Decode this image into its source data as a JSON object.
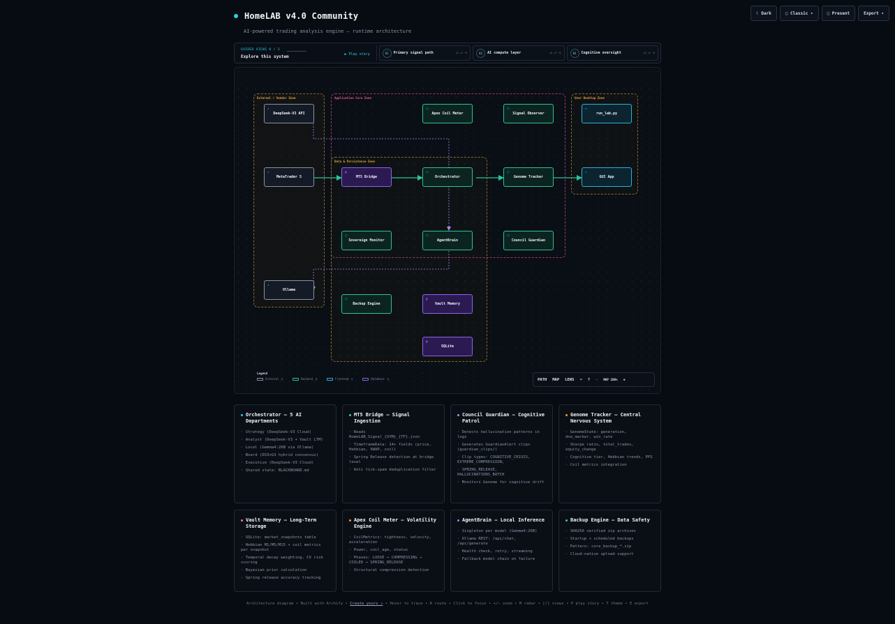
{
  "header": {
    "title": "HomeLAB v4.0 Community",
    "subtitle": "AI-powered trading analysis engine — runtime architecture"
  },
  "controls": {
    "dark": "☾ Dark",
    "classic": "▢ Classic ▾",
    "present": "▢ Present",
    "export": "Export ▾"
  },
  "guided": {
    "kicker": "GUIDED VIEWS 0 / 3",
    "heading": "Explore this system",
    "play": "▶ Play story",
    "views": [
      {
        "num": "01",
        "label": "Primary signal path",
        "stats": "+8 +5 −8"
      },
      {
        "num": "02",
        "label": "AI compute layer",
        "stats": "+8 +5 −8"
      },
      {
        "num": "03",
        "label": "Cognitive oversight",
        "stats": "+8 +5 −8"
      }
    ]
  },
  "zones": {
    "external": "External / Vendor Zone",
    "appcore": "Application Core Zone",
    "data": "Data & Persistence Zone",
    "desktop": "User Desktop Zone"
  },
  "nodes": {
    "deepseek": "DeepSeek-V3 API",
    "metatrader": "MetaTrader 5",
    "ollama": "Ollama",
    "apex": "Apex Coil Meter",
    "signal_observer": "Signal Observer",
    "run_lab": "run_lab.py",
    "mt5_bridge": "MT5 Bridge",
    "orchestrator": "Orchestrator",
    "genome_tracker": "Genome Tracker",
    "gui_app": "GUI App",
    "sovereign": "Sovereign Monitor",
    "agentbrain": "AgentBrain",
    "council": "Council Guardian",
    "backup": "Backup Engine",
    "vault": "Vault Memory",
    "sqlite": "SQLite"
  },
  "legend": {
    "title": "Legend",
    "items": [
      {
        "label": "External",
        "count": "3",
        "color": "#8793a6"
      },
      {
        "label": "Backend",
        "count": "8",
        "color": "#2cc29a"
      },
      {
        "label": "Frontend",
        "count": "2",
        "color": "#2bb3d6"
      },
      {
        "label": "Database",
        "count": "3",
        "color": "#8b63e6"
      }
    ]
  },
  "map_controls": {
    "path": "PATH",
    "map": "MAP",
    "lens": "LENS",
    "search": "⌕",
    "help": "?",
    "minus": "−",
    "zoom": "MAP 100%",
    "plus": "+"
  },
  "cards": [
    {
      "title": "Orchestrator — 5 AI Departments",
      "color": "#22d3ee",
      "items": [
        "Strategy (DeepSeek-V3 Cloud)",
        "Analyst (DeepSeek-V3 + Vault LTM)",
        "Local (Gemma4:26B via Ollama)",
        "Board (DS3+G3 hybrid consensus)",
        "Executive (DeepSeek-V3 Cloud)",
        "Shared state: BLACKBOARD.md"
      ]
    },
    {
      "title": "MT5 Bridge — Signal Ingestion",
      "color": "#34d399",
      "items": [
        "Reads HomeLAB_Signal_{SYM}_{TF}.json",
        "TimeframeData: 14+ fields (price, Hebbian, VWAP, coil)",
        "Spring Release detection at bridge level",
        "Anti tick-spam deduplication filter"
      ]
    },
    {
      "title": "Council Guardian — Cognitive Patrol",
      "color": "#a78bfa",
      "items": [
        "Detects hallucination patterns in logs",
        "Generates GuardianAlert clips (guardian_clips/)",
        "Clip types: COGNITIVE_CRISIS, EXTREME_COMPRESSION,",
        "SPRING_RELEASE, HALLUCINATIONS_BATCH",
        "Monitors Genome for cognitive drift"
      ]
    },
    {
      "title": "Genome Tracker — Central Nervous System",
      "color": "#f59e0b",
      "items": [
        "GenomeState: generation, dna_marker, win_rate",
        "Sharpe ratio, total_trades, equity_change",
        "Cognitive tier, Hebbian trends, PPS",
        "Coil metrics integration"
      ]
    },
    {
      "title": "Vault Memory — Long-Term Storage",
      "color": "#f472b6",
      "items": [
        "SQLite: market_snapshots table",
        "Hebbian M1/M5/M15 + coil metrics per snapshot",
        "Temporal decay weighting, CV risk scoring",
        "Bayesian prior calculation",
        "Spring release accuracy tracking"
      ]
    },
    {
      "title": "Apex Coil Meter — Volatility Engine",
      "color": "#fb923c",
      "items": [
        "CoilMetrics: tightness, velocity, acceleration",
        "Power, coil_age, status",
        "Phases: LOOSE → COMPRESSING → COILED → SPRING_RELEASE",
        "Structural compression detection"
      ]
    },
    {
      "title": "AgentBrain — Local Inference",
      "color": "#818cf8",
      "items": [
        "Singleton per model (Gemma4:26B)",
        "Ollama REST: /api/chat, /api/generate",
        "Health check, retry, streaming",
        "Fallback model chain on failure"
      ]
    },
    {
      "title": "Backup Engine — Data Safety",
      "color": "#34d399",
      "items": [
        "SHA256 verified zip archives",
        "Startup + scheduled backups",
        "Pattern: core_backup_*.zip",
        "Cloud-native upload support"
      ]
    }
  ],
  "footer": {
    "before": "Architecture diagram • Built with Archify •",
    "link": "Create yours ↗",
    "after": "• Hover to trace • R route • Click to focus • +/− zoom • M radar • [/] views • P play story • T theme • E export"
  }
}
